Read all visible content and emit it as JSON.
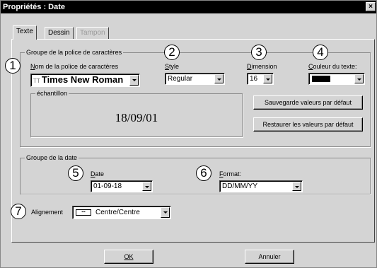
{
  "window": {
    "title": "Propriétés : Date",
    "close_glyph": "×"
  },
  "tabs": [
    {
      "label": "Texte",
      "state": "active"
    },
    {
      "label": "Dessin",
      "state": "normal"
    },
    {
      "label": "Tampon",
      "state": "disabled"
    }
  ],
  "callouts": [
    "1",
    "2",
    "3",
    "4",
    "5",
    "6",
    "7"
  ],
  "font_group": {
    "legend": "Groupe de la police de caractères",
    "font_name_label": "Nom de la police de caractères",
    "font_name_value": "Times New Roman",
    "style_label": "Style",
    "style_value": "Regular",
    "size_label": "Dimension",
    "size_value": "16",
    "color_label": "Couleur du texte:",
    "color_value": "#000000",
    "sample_legend": "échantillon",
    "sample_text": "18/09/01",
    "save_defaults_label": "Sauvegarde valeurs par défaut",
    "restore_defaults_label": "Restaurer les valeurs par défaut"
  },
  "date_group": {
    "legend": "Groupe de la date",
    "date_label": "Date",
    "date_value": "01-09-18",
    "format_label": "Format:",
    "format_value": "DD/MM/YY"
  },
  "alignment": {
    "label": "Alignement",
    "value": "Centre/Centre"
  },
  "footer": {
    "ok_label": "OK",
    "cancel_label": "Annuler"
  }
}
